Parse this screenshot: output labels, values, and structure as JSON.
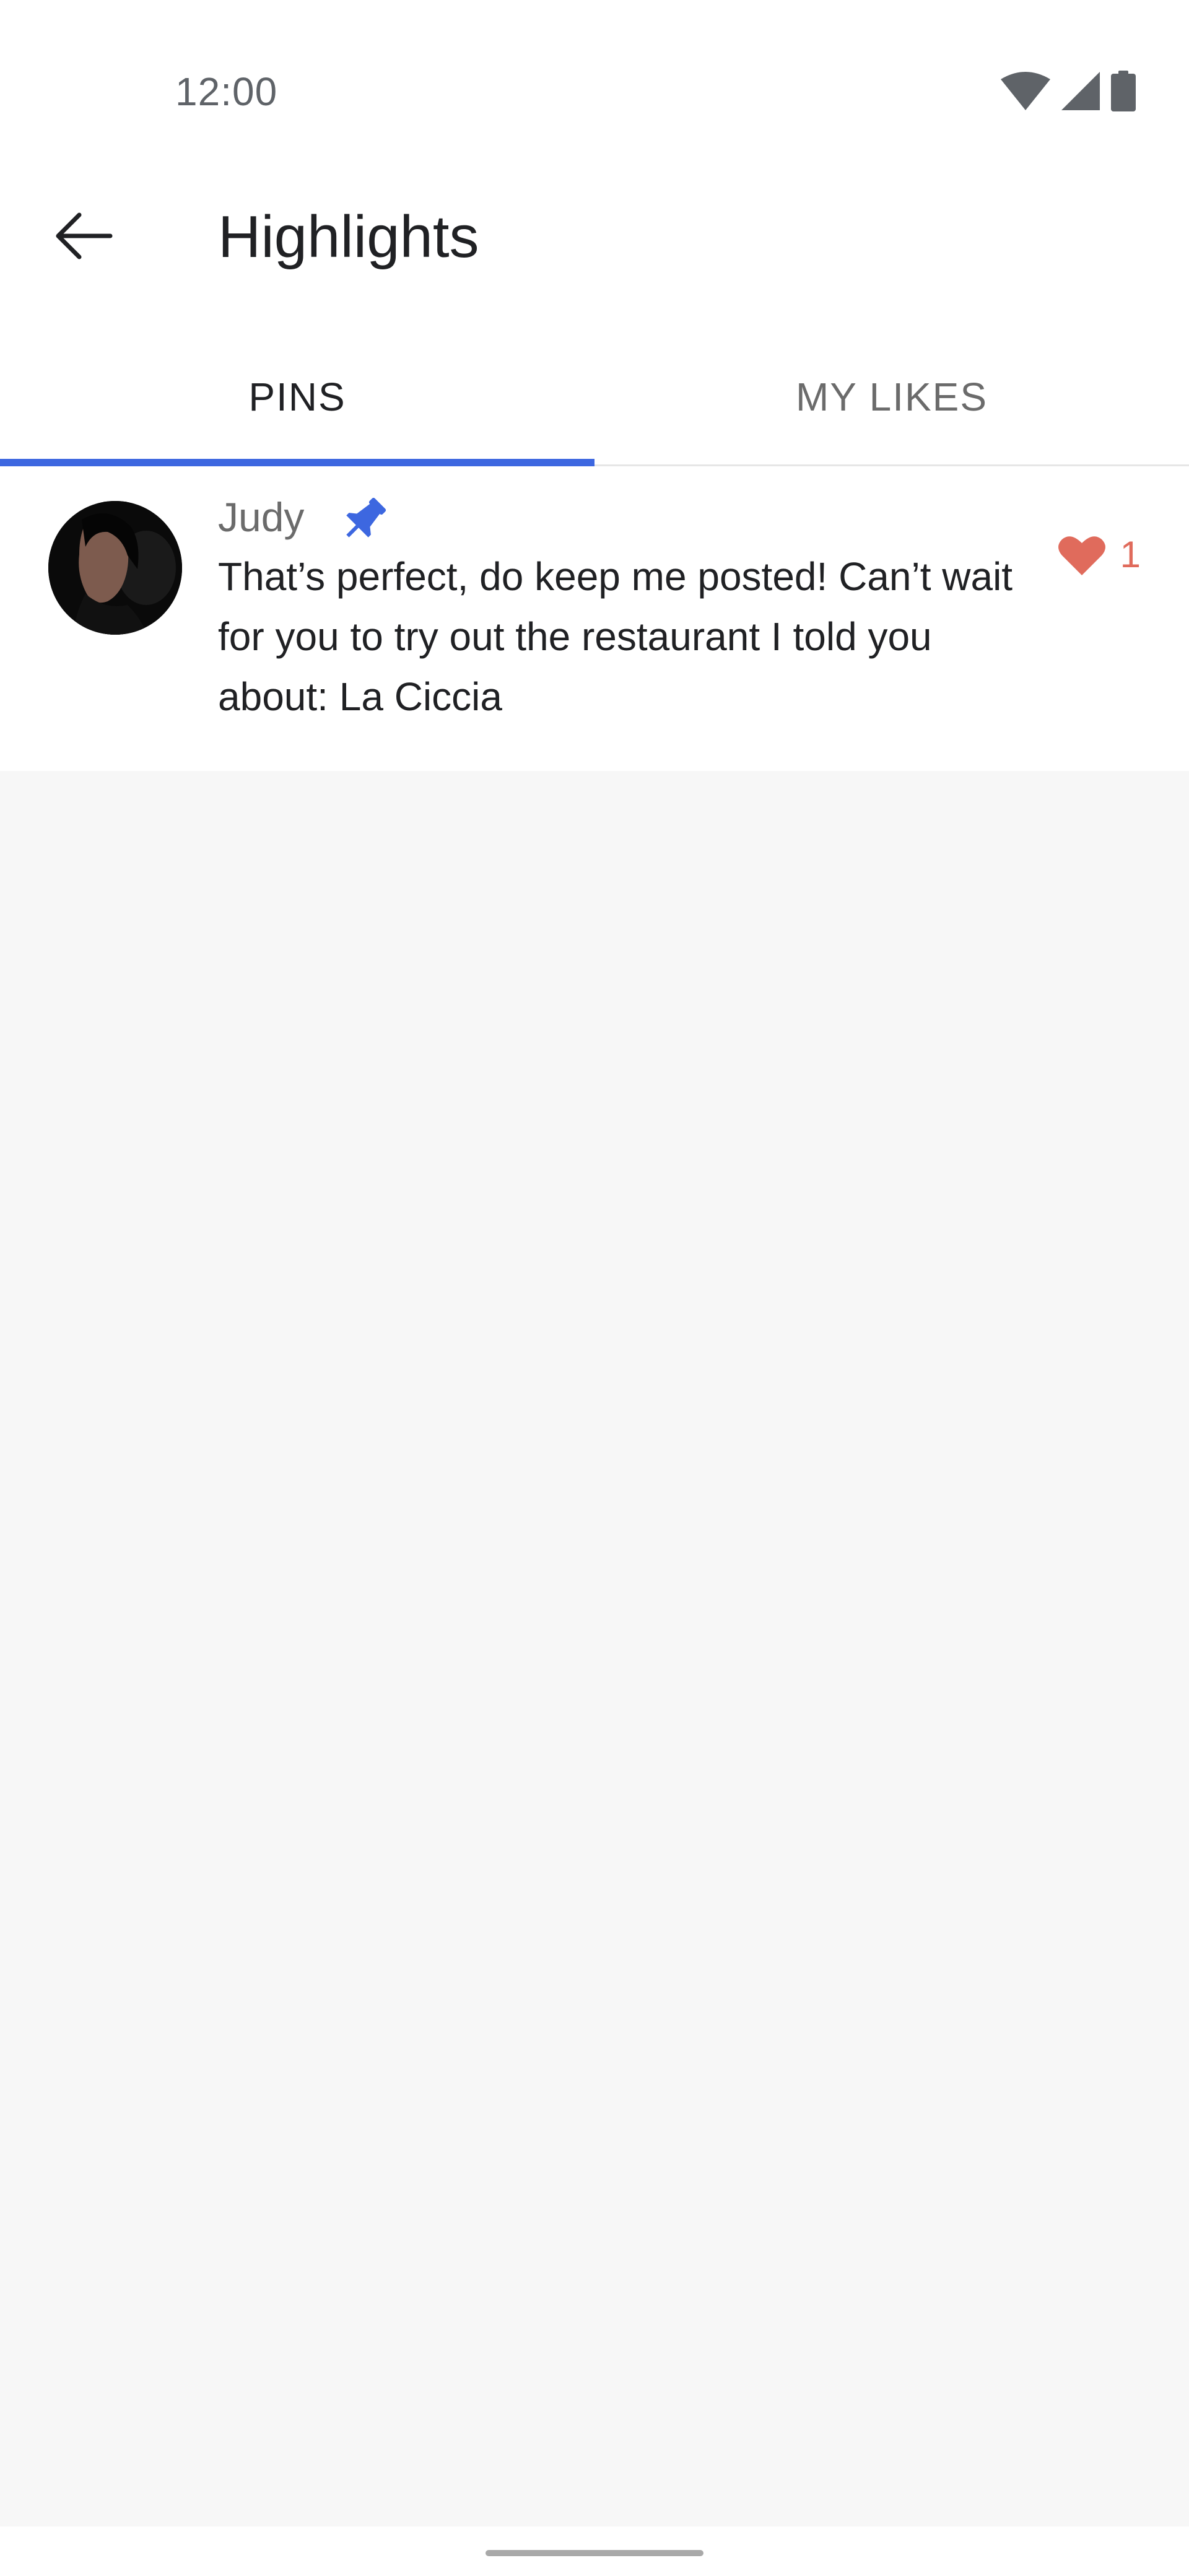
{
  "status_bar": {
    "time": "12:00",
    "icons": [
      "wifi-icon",
      "cell-signal-icon",
      "battery-icon"
    ]
  },
  "app_bar": {
    "back_icon": "arrow-back-icon",
    "title": "Highlights"
  },
  "tabs": [
    {
      "label": "PINS",
      "active": true
    },
    {
      "label": "MY LIKES",
      "active": false
    }
  ],
  "highlights": [
    {
      "sender": "Judy",
      "pinned_icon": "pin-icon",
      "message": "That’s perfect, do keep me posted! Can’t wait for you to try out the restaurant I told you about: La Ciccia",
      "like_icon": "heart-icon",
      "likes": "1"
    }
  ],
  "colors": {
    "accent": "#3d67e0",
    "like": "#e06b5c",
    "text_primary": "#202124",
    "text_secondary": "#6b6b6b",
    "list_background": "#f7f7f7"
  },
  "nav_bar": {
    "handle": "gesture-handle"
  }
}
